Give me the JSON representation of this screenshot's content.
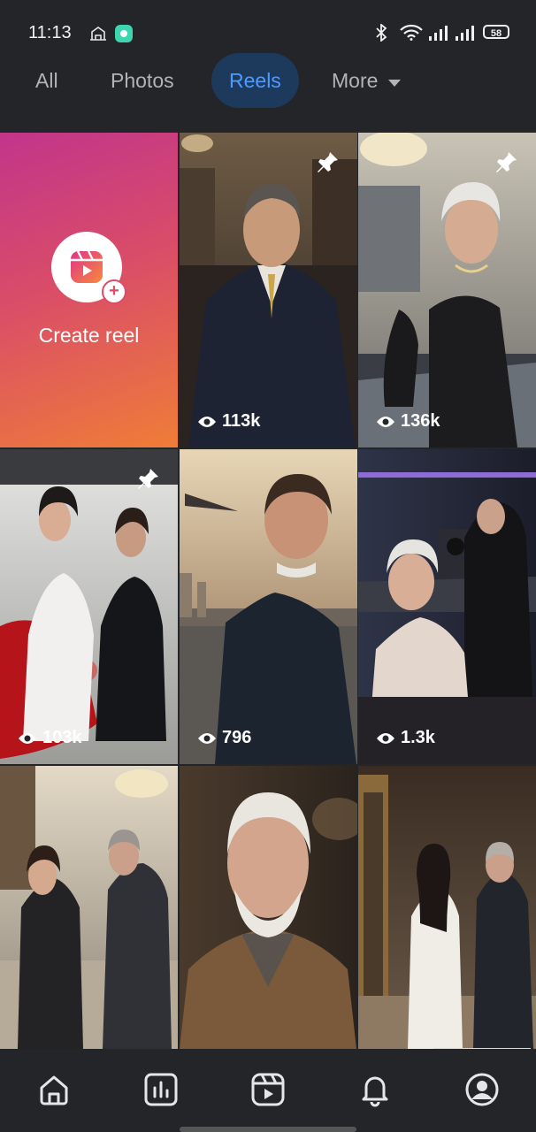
{
  "status": {
    "time": "11:13",
    "battery": "58",
    "icons": [
      "carrier-icon",
      "app-notification-icon",
      "bluetooth-icon",
      "wifi-icon",
      "signal-icon",
      "signal-icon",
      "battery-icon"
    ]
  },
  "tabs": [
    {
      "label": "All",
      "active": false
    },
    {
      "label": "Photos",
      "active": false
    },
    {
      "label": "Reels",
      "active": true
    },
    {
      "label": "More",
      "active": false,
      "icon": "caret-down-icon"
    }
  ],
  "create": {
    "label": "Create reel",
    "icon": "reels-icon"
  },
  "reels": [
    {
      "views": "113k",
      "pinned": true,
      "subject": "man in pinstripe suit in luxury lounge"
    },
    {
      "views": "136k",
      "pinned": true,
      "subject": "elderly woman at jewelry display"
    },
    {
      "views": "103k",
      "pinned": true,
      "subject": "two women by red car in showroom"
    },
    {
      "views": "796",
      "pinned": false,
      "subject": "pilot on helipad at sunset"
    },
    {
      "views": "1.3k",
      "pinned": false,
      "subject": "elderly woman in recording studio"
    },
    {
      "views": "",
      "pinned": false,
      "subject": "people in hotel lobby"
    },
    {
      "views": "",
      "pinned": false,
      "subject": "elderly man in jacket"
    },
    {
      "views": "",
      "pinned": false,
      "subject": "people in art gallery"
    }
  ],
  "nav": [
    {
      "name": "home-icon"
    },
    {
      "name": "insights-icon"
    },
    {
      "name": "reels-icon"
    },
    {
      "name": "notifications-icon"
    },
    {
      "name": "profile-icon"
    }
  ],
  "colors": {
    "accent": "#4e9bff",
    "background": "#232529",
    "active_tab_bg": "#1d3a5c"
  }
}
